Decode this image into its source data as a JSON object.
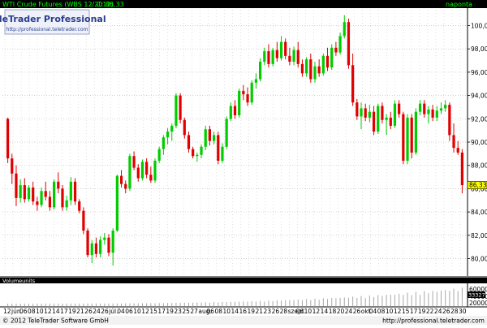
{
  "header": {
    "instrument": "WTI Crude Futures (WBS 12/2012)",
    "last_label": "C: 86,33",
    "period": "naponta"
  },
  "watermark": {
    "brand": "TeleTrader Professional",
    "url": "http://professional.teletrader.com"
  },
  "volume_panel": {
    "title": "Volumeunits",
    "yticks": [
      "60000",
      "40000",
      "20000"
    ],
    "current_value": "33327"
  },
  "footer": {
    "copyright": "© 2012 TeleTrader Software GmbH",
    "url": "http://professional.teletrader.com"
  },
  "price_axis": {
    "ticks": [
      "100,00",
      "98,00",
      "96,00",
      "94,00",
      "92,00",
      "90,00",
      "88,00",
      "86,00",
      "84,00",
      "82,00",
      "80,00"
    ],
    "current": "86,33"
  },
  "date_axis": {
    "labels": [
      "12",
      "jún.",
      "06",
      "08",
      "10",
      "12",
      "14",
      "17",
      "19",
      "21",
      "26",
      "24",
      "26",
      "júl.",
      "04",
      "06",
      "10",
      "12",
      "15",
      "17",
      "19",
      "23",
      "25",
      "27",
      "aug.",
      "06",
      "08",
      "10",
      "14",
      "16",
      "19",
      "21",
      "23",
      "26",
      "28",
      "szept.",
      "06",
      "10",
      "12",
      "14",
      "18",
      "20",
      "24",
      "26",
      "okt.",
      "04",
      "08",
      "10",
      "12",
      "15",
      "17",
      "19",
      "22",
      "24",
      "26",
      "28",
      "30"
    ]
  },
  "colors": {
    "up": "#00cc00",
    "down": "#e00000",
    "grid": "#c0c0c0",
    "header_bg": "#000000",
    "header_text": "#00ff00",
    "price_tag": "#ffff00",
    "volume": "#a8a8a8"
  },
  "chart_data": {
    "type": "candlestick",
    "y_axis_range": [
      78.5,
      101.5
    ],
    "candles": [
      [
        92,
        92.1,
        88.2,
        88.6
      ],
      [
        88.6,
        89,
        86.4,
        87.3
      ],
      [
        87.3,
        88,
        84.5,
        85.2
      ],
      [
        85.2,
        86.8,
        84.8,
        86.3
      ],
      [
        86.3,
        86.9,
        84.8,
        85.1
      ],
      [
        85.1,
        86.3,
        84.9,
        86.1
      ],
      [
        86.1,
        86.6,
        84.6,
        84.9
      ],
      [
        84.9,
        85.3,
        84.1,
        84.6
      ],
      [
        84.6,
        86.1,
        84.4,
        85.8
      ],
      [
        85.8,
        86.6,
        85,
        85.3
      ],
      [
        85.3,
        85.8,
        84.1,
        84.4
      ],
      [
        84.4,
        86.8,
        84.2,
        86.6
      ],
      [
        86.6,
        87.4,
        85.6,
        86
      ],
      [
        86,
        86.3,
        84.1,
        84.4
      ],
      [
        84.4,
        85.4,
        84.1,
        85
      ],
      [
        85,
        87,
        84.6,
        86.6
      ],
      [
        86.6,
        86.9,
        84.6,
        84.9
      ],
      [
        84.9,
        85.1,
        83.9,
        84.1
      ],
      [
        84.1,
        84.4,
        82.1,
        82.4
      ],
      [
        82.4,
        82.6,
        80.1,
        80.3
      ],
      [
        80.3,
        81.6,
        79.6,
        81.3
      ],
      [
        81.3,
        81.8,
        80.1,
        80.4
      ],
      [
        80.4,
        81.9,
        80.1,
        81.6
      ],
      [
        81.6,
        82.2,
        81.2,
        81.8
      ],
      [
        81.8,
        82.1,
        80.2,
        80.5
      ],
      [
        80.5,
        82.6,
        79.4,
        82.4
      ],
      [
        82.4,
        87.2,
        82.3,
        87.1
      ],
      [
        87.1,
        87.6,
        86.1,
        86.4
      ],
      [
        86.4,
        86.7,
        85.6,
        86
      ],
      [
        86,
        89,
        85.8,
        88.8
      ],
      [
        88.8,
        89.2,
        87.6,
        87.8
      ],
      [
        87.8,
        88.1,
        86.6,
        86.9
      ],
      [
        86.9,
        88.5,
        86.7,
        88.3
      ],
      [
        88.3,
        88.6,
        86.9,
        87.2
      ],
      [
        87.2,
        87.9,
        86.5,
        86.7
      ],
      [
        86.7,
        88.6,
        86.5,
        88.4
      ],
      [
        88.4,
        89.6,
        88.2,
        89.4
      ],
      [
        89.4,
        90.6,
        88.9,
        90.4
      ],
      [
        90.4,
        91.2,
        89.8,
        90.9
      ],
      [
        90.9,
        91.6,
        90.1,
        91.4
      ],
      [
        91.4,
        94.2,
        91.2,
        94
      ],
      [
        94,
        94.2,
        91.6,
        91.9
      ],
      [
        91.9,
        92.1,
        90.3,
        90.6
      ],
      [
        90.6,
        90.9,
        89.1,
        89.4
      ],
      [
        89.4,
        89.6,
        88.6,
        88.8
      ],
      [
        88.8,
        89.1,
        88.3,
        88.9
      ],
      [
        88.9,
        89.8,
        88.6,
        89.6
      ],
      [
        89.6,
        91.4,
        89.3,
        91.1
      ],
      [
        91.1,
        91.4,
        89.7,
        90.1
      ],
      [
        90.1,
        90.9,
        89.8,
        90.6
      ],
      [
        90.6,
        90.9,
        88.1,
        88.4
      ],
      [
        88.4,
        89.9,
        88.2,
        89.6
      ],
      [
        89.6,
        92.2,
        89.4,
        92
      ],
      [
        92,
        93.4,
        91.8,
        93.1
      ],
      [
        93.1,
        93.6,
        92,
        92.3
      ],
      [
        92.3,
        94.6,
        92.1,
        94.4
      ],
      [
        94.4,
        94.9,
        93.6,
        94.1
      ],
      [
        94.1,
        94.7,
        93.1,
        93.4
      ],
      [
        93.4,
        95.3,
        93.2,
        95.1
      ],
      [
        95.1,
        95.9,
        94.6,
        95.4
      ],
      [
        95.4,
        97.2,
        95.2,
        96.9
      ],
      [
        96.9,
        98.1,
        96.6,
        97.8
      ],
      [
        97.8,
        98.4,
        96.4,
        96.7
      ],
      [
        96.7,
        98.1,
        96.5,
        97.9
      ],
      [
        97.9,
        98.6,
        96.9,
        97.2
      ],
      [
        97.2,
        99.1,
        97,
        98.6
      ],
      [
        98.6,
        98.9,
        97.1,
        97.4
      ],
      [
        97.4,
        98.1,
        96.6,
        96.9
      ],
      [
        96.9,
        98.2,
        96.6,
        97.9
      ],
      [
        97.9,
        98.6,
        96.4,
        96.7
      ],
      [
        96.7,
        97.1,
        95.6,
        95.9
      ],
      [
        95.9,
        97.3,
        95.6,
        97.1
      ],
      [
        97.1,
        97.6,
        95.1,
        95.4
      ],
      [
        95.4,
        96.9,
        95.1,
        96.5
      ],
      [
        96.5,
        97.1,
        95.6,
        95.9
      ],
      [
        95.9,
        97.6,
        95.7,
        97.4
      ],
      [
        97.4,
        98.1,
        96.1,
        96.4
      ],
      [
        96.4,
        98.4,
        96.2,
        98.1
      ],
      [
        98.1,
        98.6,
        97.4,
        97.7
      ],
      [
        97.7,
        99.4,
        97.5,
        99.1
      ],
      [
        99.1,
        100.9,
        98.9,
        100.3
      ],
      [
        100.3,
        100.6,
        96.3,
        96.6
      ],
      [
        96.6,
        97.6,
        93.1,
        93.4
      ],
      [
        93.4,
        93.7,
        91.9,
        92.2
      ],
      [
        92.2,
        93.4,
        91.1,
        92.9
      ],
      [
        92.9,
        93.3,
        91.8,
        92.1
      ],
      [
        92.1,
        93.2,
        91.7,
        92.6
      ],
      [
        92.6,
        93.1,
        90.6,
        90.9
      ],
      [
        90.9,
        93.3,
        90.7,
        93.1
      ],
      [
        93.1,
        93.4,
        91.6,
        91.9
      ],
      [
        91.9,
        92.4,
        90.6,
        92.1
      ],
      [
        92.1,
        92.6,
        91.1,
        91.4
      ],
      [
        91.4,
        93.6,
        91.2,
        93.3
      ],
      [
        93.3,
        93.6,
        92.1,
        92.4
      ],
      [
        92.4,
        92.6,
        88.1,
        88.4
      ],
      [
        88.4,
        92.4,
        88.1,
        92.1
      ],
      [
        92.1,
        92.4,
        88.6,
        89.1
      ],
      [
        89.1,
        92.9,
        88.9,
        92.6
      ],
      [
        92.6,
        93.6,
        92.3,
        93.3
      ],
      [
        93.3,
        93.6,
        92.1,
        92.4
      ],
      [
        92.4,
        93.1,
        91.6,
        92.8
      ],
      [
        92.8,
        93.2,
        91.8,
        92.1
      ],
      [
        92.1,
        93.1,
        91.8,
        92.7
      ],
      [
        92.7,
        93.4,
        92.4,
        92.9
      ],
      [
        92.9,
        93.6,
        92.6,
        93.2
      ],
      [
        93.2,
        93.4,
        90.1,
        90.6
      ],
      [
        90.6,
        91.6,
        89.1,
        89.5
      ],
      [
        89.5,
        90.1,
        88.9,
        89.1
      ],
      [
        89.1,
        89.4,
        85.6,
        86.3
      ]
    ]
  }
}
